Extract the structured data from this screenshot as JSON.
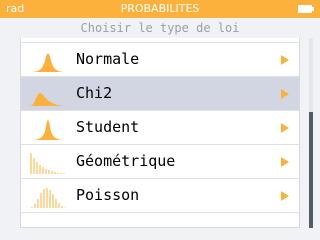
{
  "status_bar": {
    "mode": "rad",
    "title": "PROBABILITES",
    "accent_color": "#fbb13b",
    "battery_icon": "battery-icon"
  },
  "subtitle": "Choisir le type de loi",
  "laws": [
    {
      "label": "",
      "icon": "normal-curve-icon",
      "partially_visible": true
    },
    {
      "label": "Normale",
      "icon": "normal-curve-icon"
    },
    {
      "label": "Chi2",
      "icon": "chi2-curve-icon",
      "selected": true
    },
    {
      "label": "Student",
      "icon": "student-curve-icon"
    },
    {
      "label": "Géométrique",
      "icon": "geometric-bars-icon"
    },
    {
      "label": "Poisson",
      "icon": "poisson-bars-icon"
    }
  ],
  "selection_color": "#d2d6e3",
  "scroll_position": 0.6
}
